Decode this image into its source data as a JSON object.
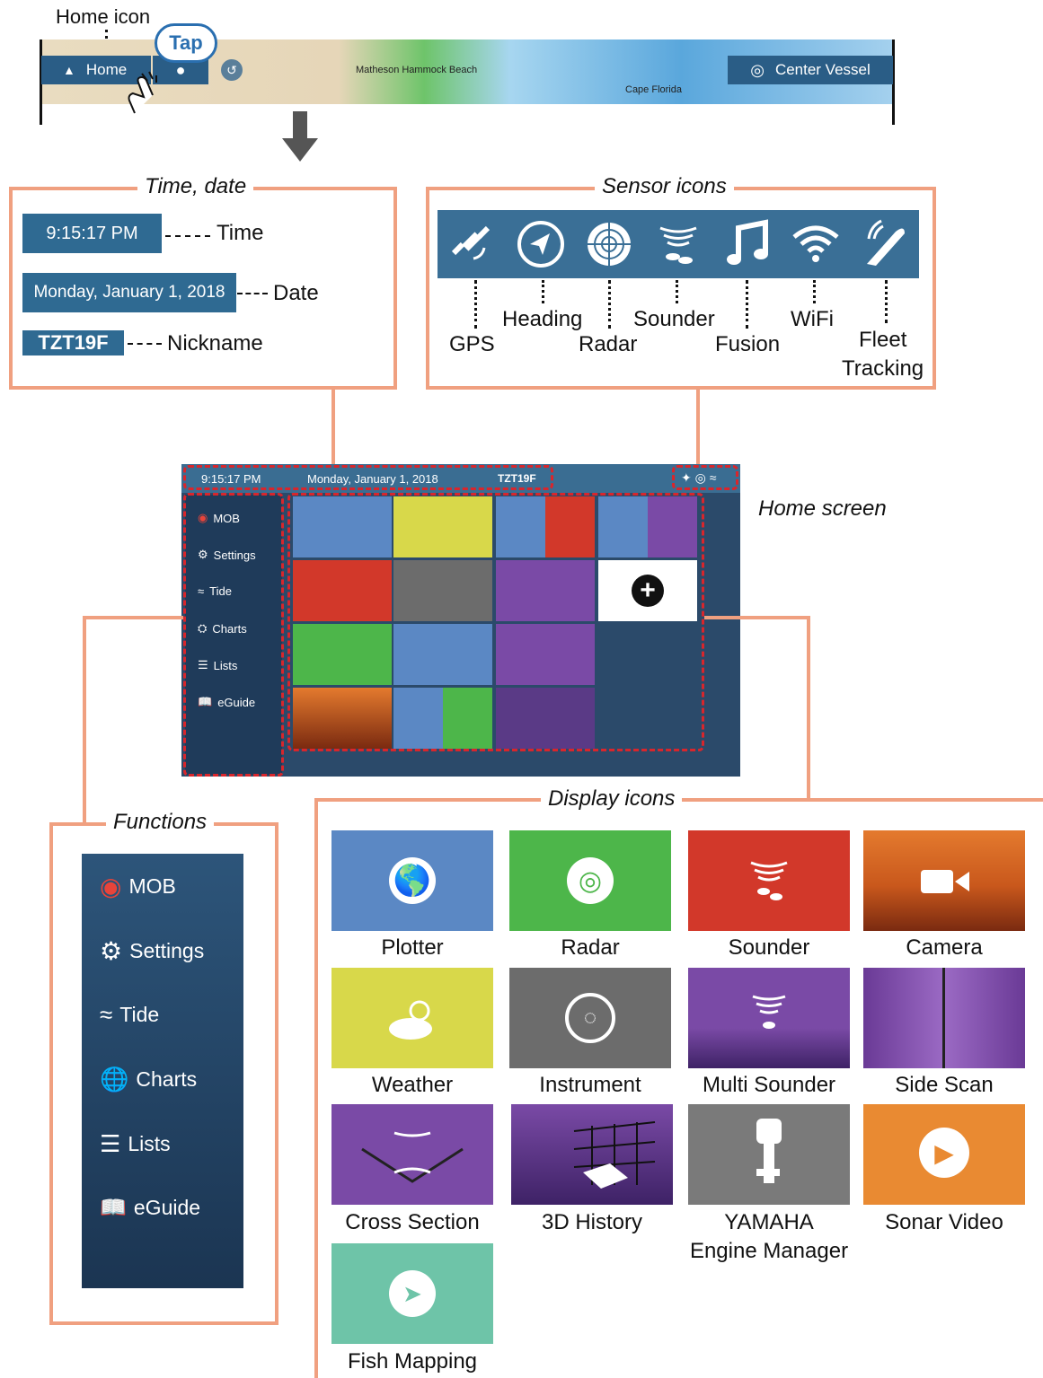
{
  "top": {
    "home_icon_label": "Home icon",
    "home_button": "Home",
    "tap": "Tap",
    "center_vessel": "Center Vessel",
    "map_place_1": "Matheson Hammock Beach",
    "map_place_2": "Cape Florida"
  },
  "time_box": {
    "title": "Time, date",
    "time_value": "9:15:17 PM",
    "time_label": "Time",
    "date_value": "Monday, January 1, 2018",
    "date_label": "Date",
    "nickname_value": "TZT19F",
    "nickname_label": "Nickname"
  },
  "sensor_box": {
    "title": "Sensor icons",
    "labels": {
      "gps": "GPS",
      "heading": "Heading",
      "radar": "Radar",
      "sounder": "Sounder",
      "fusion": "Fusion",
      "wifi": "WiFi",
      "fleet_1": "Fleet",
      "fleet_2": "Tracking"
    }
  },
  "home_screen": {
    "label": "Home screen",
    "time": "9:15:17 PM",
    "date": "Monday, January 1, 2018",
    "nickname": "TZT19F",
    "side_items": [
      "MOB",
      "Settings",
      "Tide",
      "Charts",
      "Lists",
      "eGuide"
    ]
  },
  "functions": {
    "title": "Functions",
    "items": [
      "MOB",
      "Settings",
      "Tide",
      "Charts",
      "Lists",
      "eGuide"
    ]
  },
  "display_icons": {
    "title": "Display icons",
    "items": [
      "Plotter",
      "Radar",
      "Sounder",
      "Camera",
      "Weather",
      "Instrument",
      "Multi Sounder",
      "Side Scan",
      "Cross Section",
      "3D History",
      "YAMAHA",
      "Sonar Video",
      "Fish Mapping"
    ],
    "yamaha_line2": "Engine Manager"
  },
  "colors": {
    "accent_orange": "#f0a080",
    "panel_blue": "#2f6a92",
    "dashed_red": "#d8262c",
    "plotter_blue": "#5b88c4",
    "radar_green": "#4db64a",
    "sounder_red": "#d2382a",
    "weather_yellow": "#d8d84a",
    "instrument_gray": "#6c6c6c",
    "purple": "#7a4aa6",
    "sonar_orange": "#e98a32",
    "fish_teal": "#6ec4a8"
  }
}
